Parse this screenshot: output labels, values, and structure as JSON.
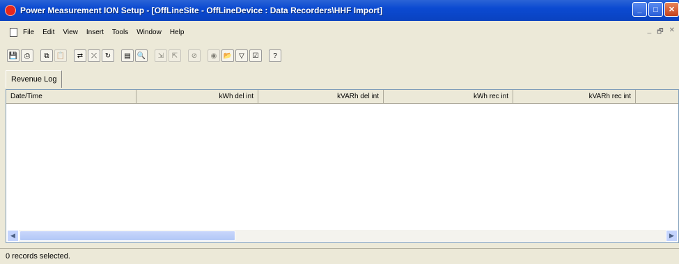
{
  "window": {
    "title": "Power Measurement ION Setup - [OffLineSite - OffLineDevice : Data Recorders\\HHF Import]"
  },
  "menu": [
    "File",
    "Edit",
    "View",
    "Insert",
    "Tools",
    "Window",
    "Help"
  ],
  "toolbar_icons": [
    "save-icon",
    "print-icon",
    "copy-icon",
    "paste-icon",
    "connect-icon",
    "disconnect-icon",
    "refresh-icon",
    "properties-icon",
    "preview-icon",
    "import-icon",
    "export-icon",
    "cancel-icon",
    "stop-icon",
    "folder-icon",
    "filter-icon",
    "checkbox-icon",
    "help-icon"
  ],
  "tab": {
    "label": "Revenue Log"
  },
  "grid": {
    "columns": [
      "Date/Time",
      "kWh del int",
      "kVARh del int",
      "kWh rec int",
      "kVARh rec int"
    ]
  },
  "status": {
    "text": "0 records selected."
  }
}
